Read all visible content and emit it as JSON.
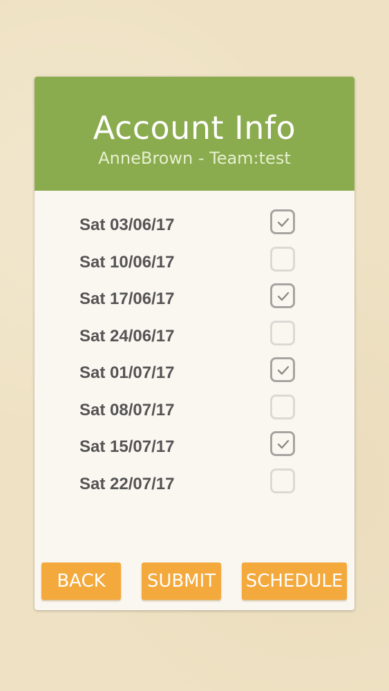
{
  "header": {
    "title": "Account Info",
    "subtitle": "AnneBrown - Team:test"
  },
  "dates": [
    {
      "label": "Sat 03/06/17",
      "checked": true
    },
    {
      "label": "Sat 10/06/17",
      "checked": false
    },
    {
      "label": "Sat 17/06/17",
      "checked": true
    },
    {
      "label": "Sat 24/06/17",
      "checked": false
    },
    {
      "label": "Sat 01/07/17",
      "checked": true
    },
    {
      "label": "Sat 08/07/17",
      "checked": false
    },
    {
      "label": "Sat 15/07/17",
      "checked": true
    },
    {
      "label": "Sat 22/07/17",
      "checked": false
    }
  ],
  "buttons": {
    "back": "BACK",
    "submit": "SUBMIT",
    "schedule": "SCHEDULE"
  },
  "colors": {
    "background": "#efe2c4",
    "header": "#8aab4e",
    "button": "#f4a93c",
    "card": "#faf7f1"
  }
}
